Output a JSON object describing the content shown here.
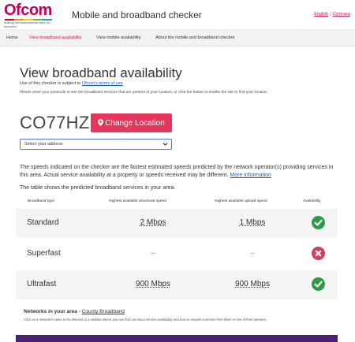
{
  "header": {
    "logo_text": "Ofcom",
    "logo_tagline": "making communications work for everyone",
    "app_title": "Mobile and broadband checker",
    "lang_english": "English",
    "lang_sep": "|",
    "lang_welsh": "Cymraeg"
  },
  "nav": {
    "items": [
      "Home",
      "View broadband availability",
      "View mobile availability",
      "About the mobile and broadband checker"
    ],
    "active_index": 1
  },
  "main": {
    "title": "View broadband availability",
    "terms_prefix": "Use of this checker is subject to ",
    "terms_link": "Ofcom's terms of use",
    "instructions": "Please enter your postcode to see the broadband services that are present at your location, or click the button to enable the site to find your location",
    "postcode": "CO77HZ",
    "change_location_label": "Change Location",
    "address_select_value": "Select your address",
    "speeds_note": "The speeds indicated on the checker are the fastest estimated speeds predicted by the network operator(s) providing services in this area. Actual service availability at a property or speeds received may be different. ",
    "more_info_link": "More information",
    "table_intro": "The table shows the predicted broadband services in your area."
  },
  "table": {
    "headers": [
      "Broadband type",
      "Highest available download speed",
      "Highest available upload speed",
      "Availability"
    ],
    "rows": [
      {
        "type": "Standard",
        "down": "2 Mbps",
        "up": "1 Mbps",
        "available": true
      },
      {
        "type": "Superfast",
        "down": "–",
        "up": "–",
        "available": false
      },
      {
        "type": "Ultrafast",
        "down": "900 Mbps",
        "up": "900 Mbps",
        "available": true
      }
    ]
  },
  "networks": {
    "label": "Networks in your area",
    "dash": " - ",
    "link": "County Broadband",
    "note": "Click on a network's name to be directed to a website where you can find out about service availability and how to request a service from them or one of their partners."
  },
  "colors": {
    "brand": "#c0005d",
    "button": "#e6365b",
    "available": "#2e9a47",
    "unavailable": "#d63d5e",
    "footer_band": "#4b2272"
  },
  "icons": {
    "available": "check-circle-icon",
    "unavailable": "x-circle-icon",
    "location": "map-pin-icon",
    "dropdown": "chevron-down-icon"
  }
}
